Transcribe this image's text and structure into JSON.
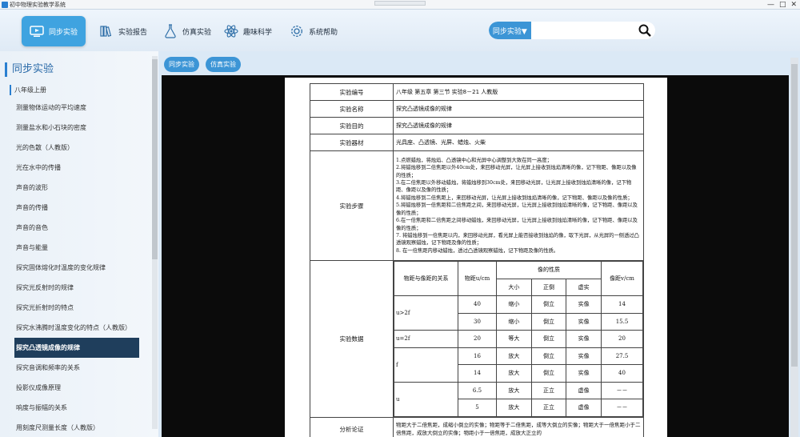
{
  "window": {
    "title": "初中物理实验教学系统"
  },
  "nav": [
    {
      "label": "同步实验",
      "icon": "monitor-icon"
    },
    {
      "label": "实验报告",
      "icon": "books-icon"
    },
    {
      "label": "仿真实验",
      "icon": "flask-icon"
    },
    {
      "label": "趣味科学",
      "icon": "atom-icon"
    },
    {
      "label": "系统帮助",
      "icon": "gear-icon"
    }
  ],
  "search": {
    "category": "同步实验▼",
    "placeholder": ""
  },
  "sidebar": {
    "heading": "同步实验",
    "grade": "八年级上册",
    "items": [
      "测量物体运动的平均速度",
      "测量盐水和小石块的密度",
      "光的色散（人教版）",
      "光在水中的传播",
      "声音的波形",
      "声音的传播",
      "声音的音色",
      "声音与能量",
      "探究固体熔化时温度的变化规律",
      "探究光反射时的规律",
      "探究光折射时的特点",
      "探究水沸腾时温度变化的特点（人教版）",
      "探究凸透镜成像的规律",
      "探究音调和频率的关系",
      "投影仪成像原理",
      "响度与振幅的关系",
      "用刻度尺测量长度（人教版）"
    ],
    "active_index": 12
  },
  "tabs": [
    "同步实验",
    "仿真实验"
  ],
  "doc": {
    "number_label": "实验编号",
    "number_value": "八年级 第五章 第三节      实验8－21 人教版",
    "name_label": "实验名称",
    "name_value": "探究凸透镜成像的规律",
    "purpose_label": "实验目的",
    "purpose_value": "探究凸透镜成像的规律",
    "equip_label": "实验器材",
    "equip_value": "光具座、凸透镜、光屏、蜡烛、火柴",
    "steps_label": "实验步骤",
    "steps": [
      "1.点燃蜡烛，将烛焰、凸透镜中心和光屏中心调整到大致在同一高度；",
      "2.将蜡烛移到二倍焦距以外40cm处，来回移动光屏，让光屏上接收到烛焰清晰的像，记下物距、像距以及像的性质；",
      "3.在二倍焦距以外移动蜡烛，将蜡烛移到30cm处，来回移动光屏，让光屏上接收到烛焰清晰的像，记下物距、像距以及像的性质；",
      "4.将蜡烛移到二倍焦距上，来回移动光屏，让光屏上接收到烛焰清晰的像，记下物距、像距以及像的性质；",
      "5.将蜡烛移到一倍焦距和二倍焦距之间，来回移动光屏，让光屏上接收到烛焰清晰的像，记下物距、像距以及像的性质；",
      "6.在一倍焦距和二倍焦距之间移动蜡烛，来回移动光屏，让光屏上接收到烛焰清晰的像，记下物距、像距以及像的性质；",
      "7. 将蜡烛移到一倍焦距以内，来回移动光屏，看光屏上能否接收到烛焰的像，取下光屏，从光屏的一侧透过凸透镜观察蜡烛，记下物距及像的性质；",
      "8. 在一倍焦距内移动蜡烛，透过凸透镜观察蜡烛，记下物距及像的性质。"
    ],
    "data_label": "实验数据",
    "table": {
      "h_relation": "物距与像距的关系",
      "h_u": "物距u/cm",
      "h_nature": "像的性质",
      "h_v": "像距v/cm",
      "h_size": "大小",
      "h_orient": "正倒",
      "h_type": "虚实",
      "groups": [
        {
          "relation": "u>2f",
          "rows": [
            {
              "u": "40",
              "size": "缩小",
              "orient": "倒立",
              "type": "实像",
              "v": "14"
            },
            {
              "u": "30",
              "size": "缩小",
              "orient": "倒立",
              "type": "实像",
              "v": "15.5"
            }
          ]
        },
        {
          "relation": "u=2f",
          "rows": [
            {
              "u": "20",
              "size": "等大",
              "orient": "倒立",
              "type": "实像",
              "v": "20"
            }
          ]
        },
        {
          "relation": "f",
          "rows": [
            {
              "u": "16",
              "size": "放大",
              "orient": "倒立",
              "type": "实像",
              "v": "27.5"
            },
            {
              "u": "14",
              "size": "放大",
              "orient": "倒立",
              "type": "实像",
              "v": "40"
            }
          ]
        },
        {
          "relation": "u",
          "rows": [
            {
              "u": "6.5",
              "size": "放大",
              "orient": "正立",
              "type": "虚像",
              "v": "－－"
            },
            {
              "u": "5",
              "size": "放大",
              "orient": "正立",
              "type": "虚像",
              "v": "－－"
            }
          ]
        }
      ]
    },
    "analysis_label": "分析论证",
    "analysis_value": "物距大于二倍焦距，成缩小倒立的实像；物距等于二倍焦距，成等大倒立的实像；物距大于一倍焦距小于二倍焦距，成放大倒立的实像；物距小于一倍焦距，成放大正立的"
  }
}
